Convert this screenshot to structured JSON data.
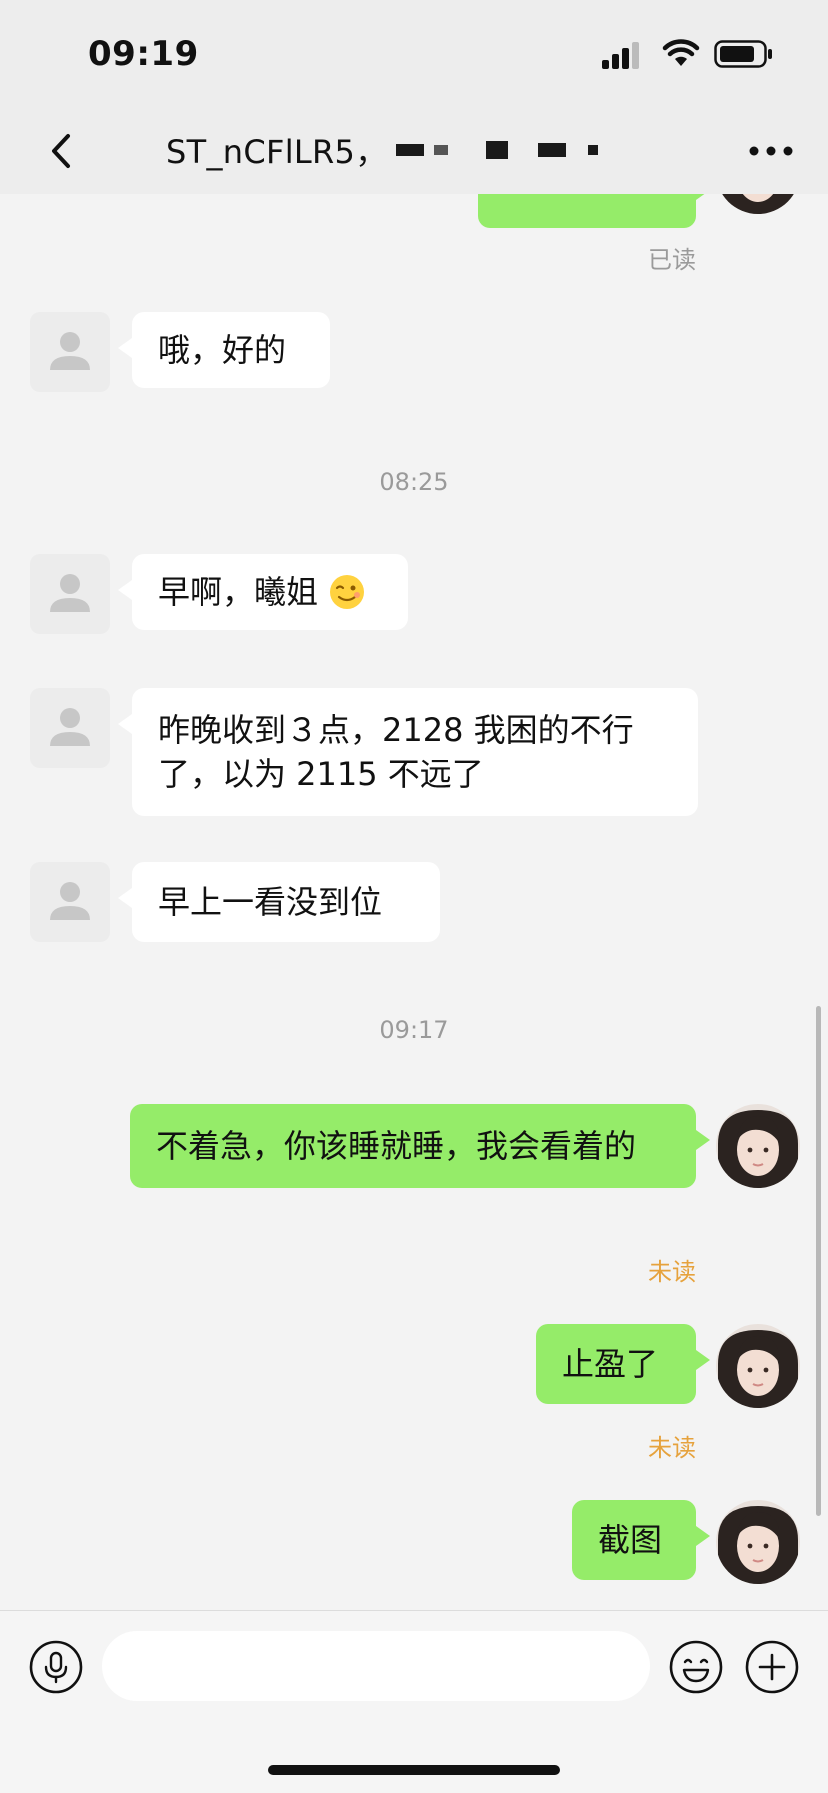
{
  "status_bar": {
    "time": "09:19"
  },
  "header": {
    "title": "ST_nCFlLR5，"
  },
  "chat": {
    "top_read": "已读",
    "messages": [
      {
        "text": "哦，好的"
      },
      {
        "text": "08:25"
      },
      {
        "text": "早啊，曦姐"
      },
      {
        "text": "昨晚收到３点，2128 我困的不行了，以为 2115 不远了"
      },
      {
        "text": "早上一看没到位"
      },
      {
        "text": "09:17"
      },
      {
        "text": "不着急，你该睡就睡，我会看着的",
        "status": "未读"
      },
      {
        "text": "止盈了",
        "status": "未读"
      },
      {
        "text": "截图"
      }
    ]
  },
  "input": {
    "placeholder": ""
  },
  "colors": {
    "bubble_out": "#95ec69",
    "bubble_in": "#ffffff",
    "unread": "#e6a23c",
    "read": "#9a9a9a"
  }
}
